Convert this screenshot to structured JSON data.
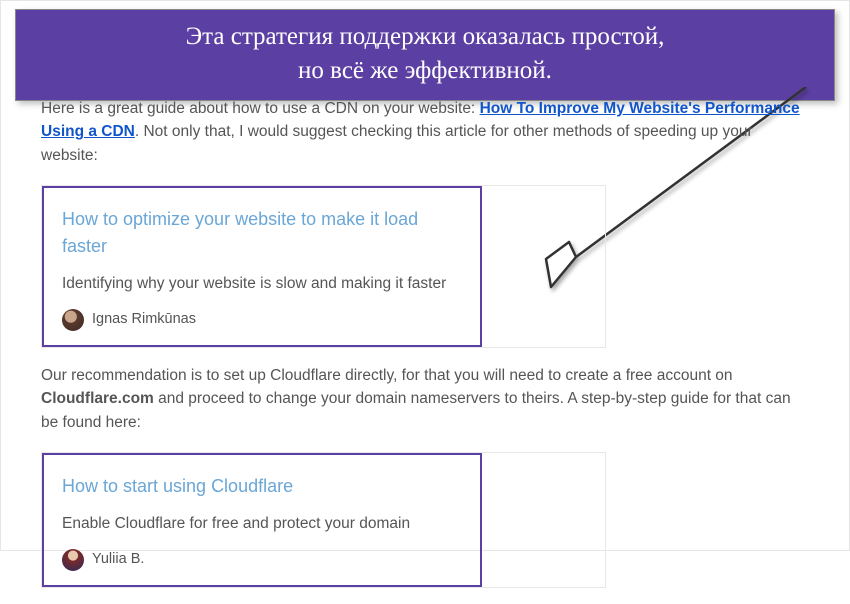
{
  "banner": {
    "line1": "Эта стратегия поддержки оказалась простой,",
    "line2": "но всё же эффективной."
  },
  "intro": {
    "part1": "Here is a great guide about how to use a CDN on your website: ",
    "link": "How To Improve My Website's Performance Using a CDN",
    "part2": ". Not only that, I would suggest checking this article for other methods of speeding up your website:"
  },
  "card1": {
    "title": "How to optimize your website to make it load faster",
    "desc": "Identifying why your website is slow and making it faster",
    "author": "Ignas Rimkūnas"
  },
  "mid": {
    "part1": "Our recommendation is to set up Cloudflare directly, for that you will need to create a free account on ",
    "bold": "Cloudflare.com",
    "part2": " and proceed to change your domain nameservers to theirs. A step-by-step guide for that can be found here:"
  },
  "card2": {
    "title": "How to start using Cloudflare",
    "desc": "Enable Cloudflare for free and protect your domain",
    "author": "Yuliia B."
  }
}
